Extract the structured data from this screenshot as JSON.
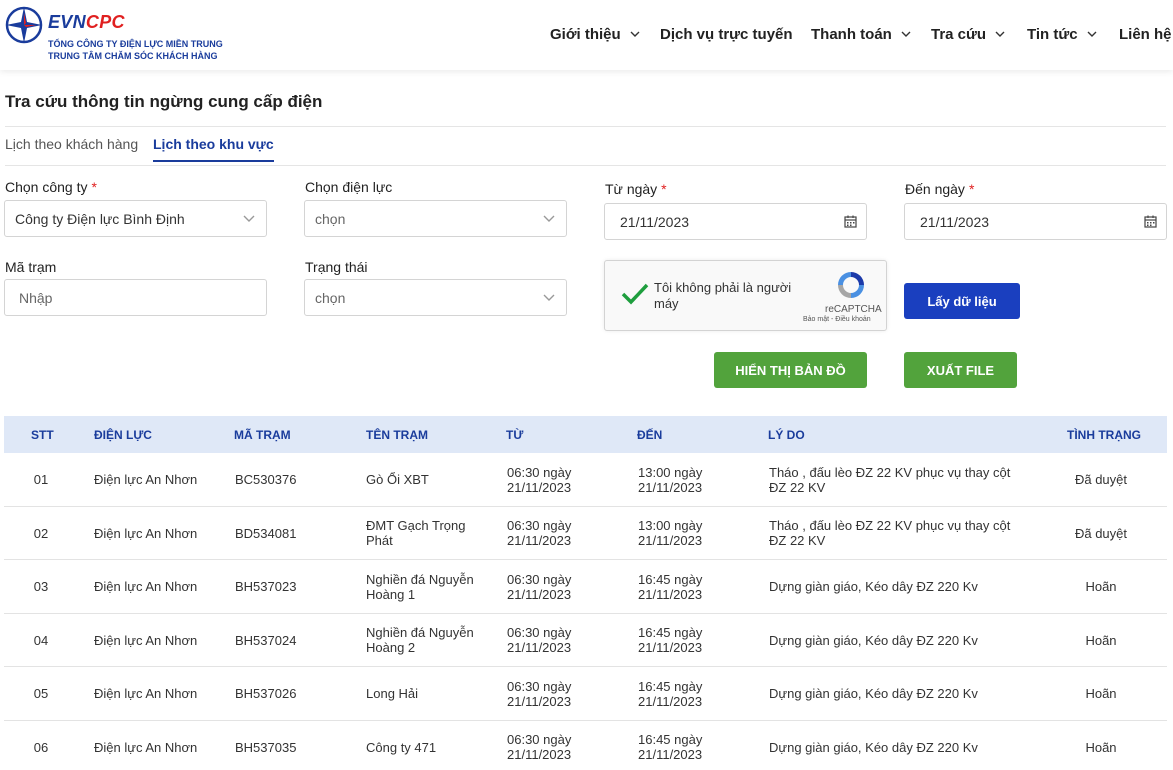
{
  "header": {
    "brand_part1": "EVN",
    "brand_part2": "CPC",
    "sub1": "TỔNG CÔNG TY ĐIỆN LỰC MIỀN TRUNG",
    "sub2": "TRUNG TÂM CHĂM SÓC KHÁCH HÀNG",
    "nav": [
      {
        "label": "Giới thiệu",
        "has_dropdown": true
      },
      {
        "label": "Dịch vụ trực tuyến",
        "has_dropdown": false
      },
      {
        "label": "Thanh toán",
        "has_dropdown": true
      },
      {
        "label": "Tra cứu",
        "has_dropdown": true
      },
      {
        "label": "Tin tức",
        "has_dropdown": true
      },
      {
        "label": "Liên hệ",
        "has_dropdown": false
      }
    ]
  },
  "page": {
    "title": "Tra cứu thông tin ngừng cung cấp điện"
  },
  "tabs": [
    {
      "label": "Lịch theo khách hàng",
      "active": false
    },
    {
      "label": "Lịch theo khu vực",
      "active": true
    }
  ],
  "form": {
    "company_label": "Chọn công ty",
    "company_value": "Công ty Điện lực Bình Định",
    "power_label": "Chọn điện lực",
    "power_placeholder": "chọn",
    "from_label": "Từ ngày",
    "from_value": "21/11/2023",
    "to_label": "Đến ngày",
    "to_value": "21/11/2023",
    "station_label": "Mã trạm",
    "station_placeholder": "Nhập",
    "status_label": "Trạng thái",
    "status_placeholder": "chọn",
    "required_mark": "*"
  },
  "captcha": {
    "text": "Tôi không phải là người máy",
    "brand": "reCAPTCHA",
    "links": "Bảo mật - Điều khoản"
  },
  "buttons": {
    "fetch": "Lấy dữ liệu",
    "map": "HIỂN THỊ BẢN ĐỒ",
    "export": "XUẤT FILE"
  },
  "table": {
    "headers": [
      "STT",
      "ĐIỆN LỰC",
      "MÃ TRẠM",
      "TÊN TRẠM",
      "TỪ",
      "ĐẾN",
      "LÝ DO",
      "TÌNH TRẠNG"
    ],
    "rows": [
      {
        "stt": "01",
        "dl": "Điện lực An Nhơn",
        "ma": "BC530376",
        "ten1": "Gò Ổi XBT",
        "ten2": "",
        "tu1": "06:30 ngày",
        "tu2": "21/11/2023",
        "den1": "13:00 ngày",
        "den2": "21/11/2023",
        "ly1": "Tháo , đấu lèo ĐZ 22 KV phục vụ thay cột",
        "ly2": "ĐZ 22 KV",
        "tt": "Đã duyệt"
      },
      {
        "stt": "02",
        "dl": "Điện lực An Nhơn",
        "ma": "BD534081",
        "ten1": "ĐMT Gạch Trọng",
        "ten2": "Phát",
        "tu1": "06:30 ngày",
        "tu2": "21/11/2023",
        "den1": "13:00 ngày",
        "den2": "21/11/2023",
        "ly1": "Tháo , đấu lèo ĐZ 22 KV phục vụ thay cột",
        "ly2": "ĐZ 22 KV",
        "tt": "Đã duyệt"
      },
      {
        "stt": "03",
        "dl": "Điện lực An Nhơn",
        "ma": "BH537023",
        "ten1": "Nghiền đá Nguyễn",
        "ten2": "Hoàng 1",
        "tu1": "06:30 ngày",
        "tu2": "21/11/2023",
        "den1": "16:45 ngày",
        "den2": "21/11/2023",
        "ly1": "Dựng giàn giáo, Kéo dây ĐZ 220 Kv",
        "ly2": "",
        "tt": "Hoãn"
      },
      {
        "stt": "04",
        "dl": "Điện lực An Nhơn",
        "ma": "BH537024",
        "ten1": "Nghiền đá Nguyễn",
        "ten2": "Hoàng 2",
        "tu1": "06:30 ngày",
        "tu2": "21/11/2023",
        "den1": "16:45 ngày",
        "den2": "21/11/2023",
        "ly1": "Dựng giàn giáo, Kéo dây ĐZ 220 Kv",
        "ly2": "",
        "tt": "Hoãn"
      },
      {
        "stt": "05",
        "dl": "Điện lực An Nhơn",
        "ma": "BH537026",
        "ten1": "Long Hải",
        "ten2": "",
        "tu1": "06:30 ngày",
        "tu2": "21/11/2023",
        "den1": "16:45 ngày",
        "den2": "21/11/2023",
        "ly1": "Dựng giàn giáo, Kéo dây ĐZ 220 Kv",
        "ly2": "",
        "tt": "Hoãn"
      },
      {
        "stt": "06",
        "dl": "Điện lực An Nhơn",
        "ma": "BH537035",
        "ten1": "Công ty 471",
        "ten2": "",
        "tu1": "06:30 ngày",
        "tu2": "21/11/2023",
        "den1": "16:45 ngày",
        "den2": "21/11/2023",
        "ly1": "Dựng giàn giáo, Kéo dây ĐZ 220 Kv",
        "ly2": "",
        "tt": "Hoãn"
      }
    ]
  },
  "colors": {
    "brand_blue": "#1a3c9c",
    "brand_red": "#e02020",
    "button_blue": "#1a3fbf",
    "button_green": "#52a33c",
    "table_header_bg": "#dfe8f7"
  },
  "icons": {
    "logo": "evn-star-logo",
    "dropdown": "chevron-down-icon",
    "calendar": "calendar-icon",
    "check": "check-icon",
    "recaptcha": "recaptcha-icon"
  }
}
